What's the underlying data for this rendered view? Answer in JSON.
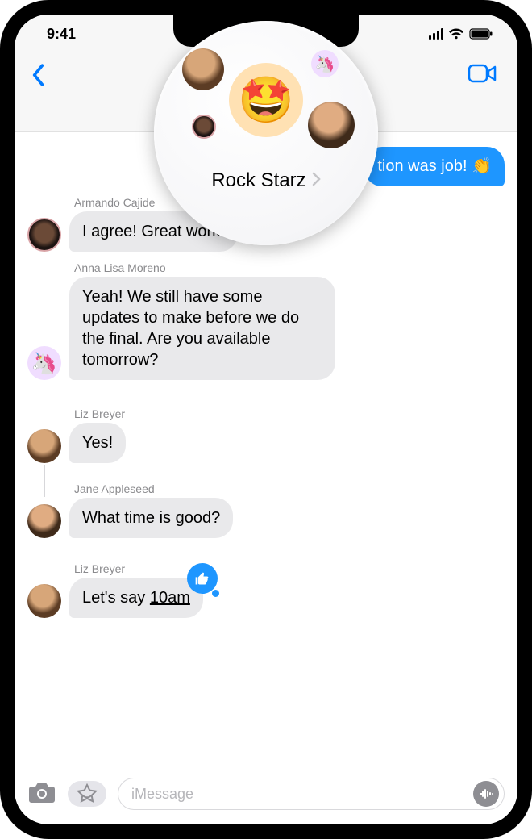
{
  "status": {
    "time": "9:41"
  },
  "header": {
    "group_name": "Rock Starz",
    "group_icon": "🤩"
  },
  "messages": {
    "outgoing_partial": "tion was job! 👏",
    "m1": {
      "sender": "Armando Cajide",
      "text": "I agree! Great work!"
    },
    "m2": {
      "sender": "Anna Lisa Moreno",
      "text": "Yeah! We still have some updates to make before we do the final. Are you available tomorrow?"
    },
    "m3": {
      "sender": "Liz Breyer",
      "text": "Yes!"
    },
    "m4": {
      "sender": "Jane Appleseed",
      "text": "What time is good?"
    },
    "m5": {
      "sender": "Liz Breyer",
      "text_prefix": "Let's say ",
      "text_time": "10am"
    }
  },
  "compose": {
    "placeholder": "iMessage"
  },
  "colors": {
    "accent": "#007AFF",
    "outgoing": "#1e96ff"
  }
}
